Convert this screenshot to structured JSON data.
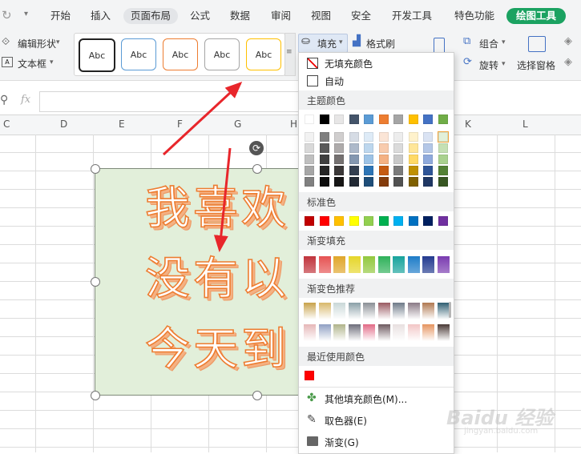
{
  "menubar": {
    "tabs": [
      "开始",
      "插入",
      "页面布局",
      "公式",
      "数据",
      "审阅",
      "视图",
      "安全",
      "开发工具",
      "特色功能",
      "绘图工具"
    ],
    "active_tab": "页面布局",
    "highlight_tab": "绘图工具"
  },
  "ribbon": {
    "edit_shape": "编辑形状",
    "textbox": "文本框",
    "style_samples": [
      "Abc",
      "Abc",
      "Abc",
      "Abc",
      "Abc"
    ],
    "fill": "填充",
    "format_painter": "格式刷",
    "group": "组合",
    "rotate": "旋转",
    "selection_pane": "选择窗格"
  },
  "formula": {
    "fx": "fx"
  },
  "columns": [
    "C",
    "D",
    "E",
    "F",
    "G",
    "H",
    "K",
    "L"
  ],
  "shape": {
    "lines": [
      "我喜欢",
      "没有以",
      "今天到"
    ]
  },
  "fill_menu": {
    "no_fill": "无填充颜色",
    "auto": "自动",
    "theme_colors_title": "主题颜色",
    "standard_colors_title": "标准色",
    "gradient_fill_title": "渐变填充",
    "gradient_recommend_title": "渐变色推荐",
    "recent_colors_title": "最近使用颜色",
    "more_colors": "其他填充颜色(M)...",
    "eyedropper": "取色器(E)",
    "gradient": "渐变(G)",
    "theme_top": [
      "#ffffff",
      "#000000",
      "#e7e6e6",
      "#44546a",
      "#5b9bd5",
      "#ed7d31",
      "#a5a5a5",
      "#ffc000",
      "#4472c4",
      "#70ad47"
    ],
    "theme_cols": [
      [
        "#f2f2f2",
        "#d9d9d9",
        "#bfbfbf",
        "#a6a6a6",
        "#808080"
      ],
      [
        "#7f7f7f",
        "#595959",
        "#404040",
        "#262626",
        "#0d0d0d"
      ],
      [
        "#d0cece",
        "#aeabab",
        "#757171",
        "#3b3838",
        "#171616"
      ],
      [
        "#d6dce5",
        "#adb9ca",
        "#8497b0",
        "#333f50",
        "#222a35"
      ],
      [
        "#deebf7",
        "#bdd7ee",
        "#9dc3e6",
        "#2e75b6",
        "#1f4e79"
      ],
      [
        "#fbe5d6",
        "#f8cbad",
        "#f4b183",
        "#c55a11",
        "#843c0c"
      ],
      [
        "#ededed",
        "#dbdbdb",
        "#c9c9c9",
        "#7b7b7b",
        "#525252"
      ],
      [
        "#fff2cc",
        "#ffe699",
        "#ffd966",
        "#bf9000",
        "#7f6000"
      ],
      [
        "#dae3f3",
        "#b4c7e7",
        "#8faadc",
        "#2f5597",
        "#203864"
      ],
      [
        "#e2f0d9",
        "#c5e0b4",
        "#a9d18e",
        "#548235",
        "#385723"
      ]
    ],
    "standard": [
      "#c00000",
      "#ff0000",
      "#ffc000",
      "#ffff00",
      "#92d050",
      "#00b050",
      "#00b0f0",
      "#0070c0",
      "#002060",
      "#7030a0"
    ],
    "gradient_fill": [
      "#c0343c",
      "#e65353",
      "#e0a62a",
      "#e6d62a",
      "#92c83e",
      "#2fb15a",
      "#17a39c",
      "#1e7cc8",
      "#233a8f",
      "#7a3bb0"
    ],
    "gradient_recommend": [
      "#c8a24a",
      "#d8b86a",
      "#c9d7d7",
      "#8aa0a8",
      "#8a8f95",
      "#9a5a62",
      "#6e7a88",
      "#8a7a86",
      "#b07850",
      "#2f5f72",
      "#e6b7b8",
      "#8f9fc3",
      "#b0b48a",
      "#6d6d7a",
      "#e26a86",
      "#6e5a60",
      "#e8e0e0",
      "#f2c6c6",
      "#e59460",
      "#4a3a36"
    ],
    "recent": [
      "#ff0000"
    ]
  },
  "watermark": {
    "text": "Baidu 经验",
    "sub": "jingyan.baidu.com"
  }
}
